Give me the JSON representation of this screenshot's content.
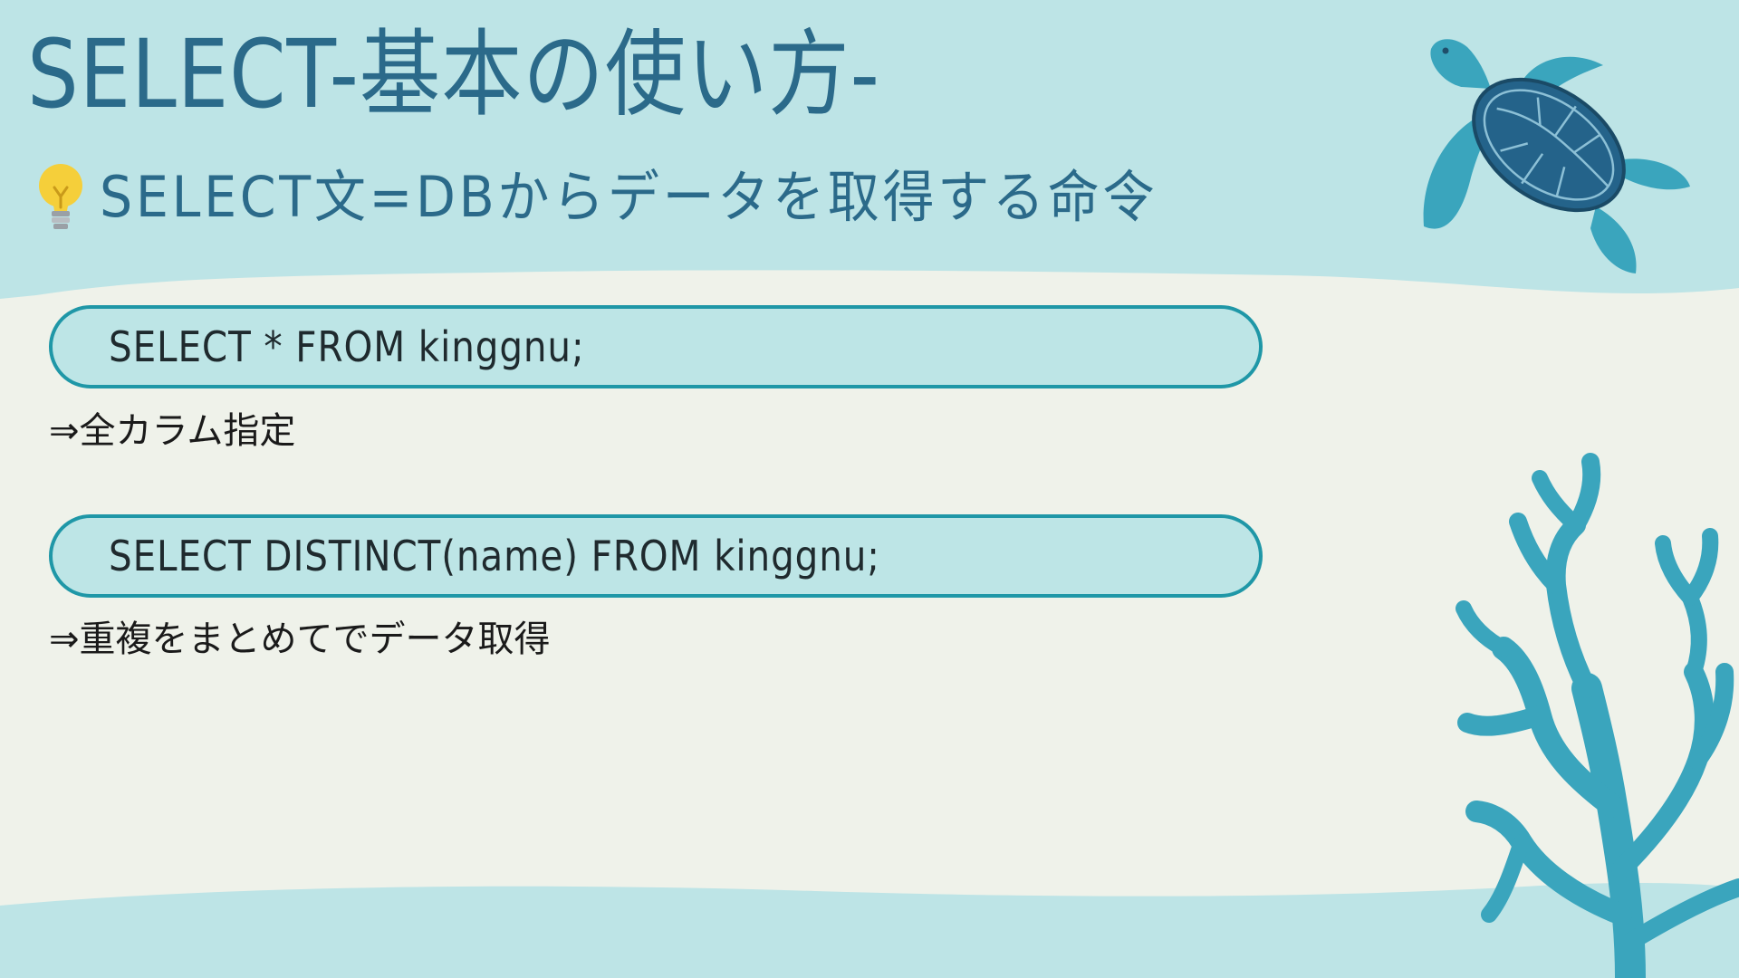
{
  "slide": {
    "title": "SELECT-基本の使い方-",
    "subtitle": "SELECT文=DBからデータを取得する命令"
  },
  "examples": [
    {
      "code": "SELECT * FROM kinggnu;",
      "description": "⇒全カラム指定"
    },
    {
      "code": "SELECT DISTINCT(name) FROM kinggnu;",
      "description": "⇒重複をまとめてでデータ取得"
    }
  ],
  "decorations": {
    "icons": [
      "lightbulb-icon",
      "sea-turtle-illustration",
      "coral-illustration"
    ]
  },
  "colors": {
    "background": "#eff2ea",
    "header_band": "#bde4e6",
    "title_text": "#2b6a8a",
    "code_box_fill": "#bde5e6",
    "code_box_border": "#1f97a7",
    "turtle_shell": "#24638a",
    "turtle_skin": "#3aa5bd",
    "coral": "#3aa5bd"
  }
}
